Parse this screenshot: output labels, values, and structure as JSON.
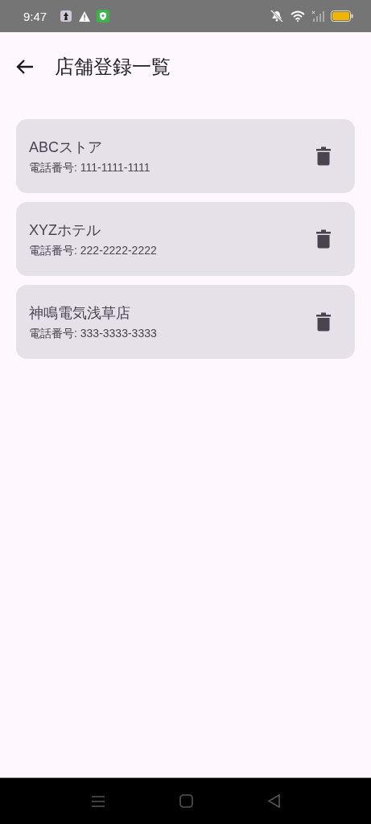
{
  "status_bar": {
    "time": "9:47"
  },
  "app_bar": {
    "title": "店舗登録一覧"
  },
  "stores": [
    {
      "name": "ABCストア",
      "phone": "電話番号: 111-1111-1111"
    },
    {
      "name": "XYZホテル",
      "phone": "電話番号: 222-2222-2222"
    },
    {
      "name": "神鳴電気浅草店",
      "phone": "電話番号: 333-3333-3333"
    }
  ]
}
